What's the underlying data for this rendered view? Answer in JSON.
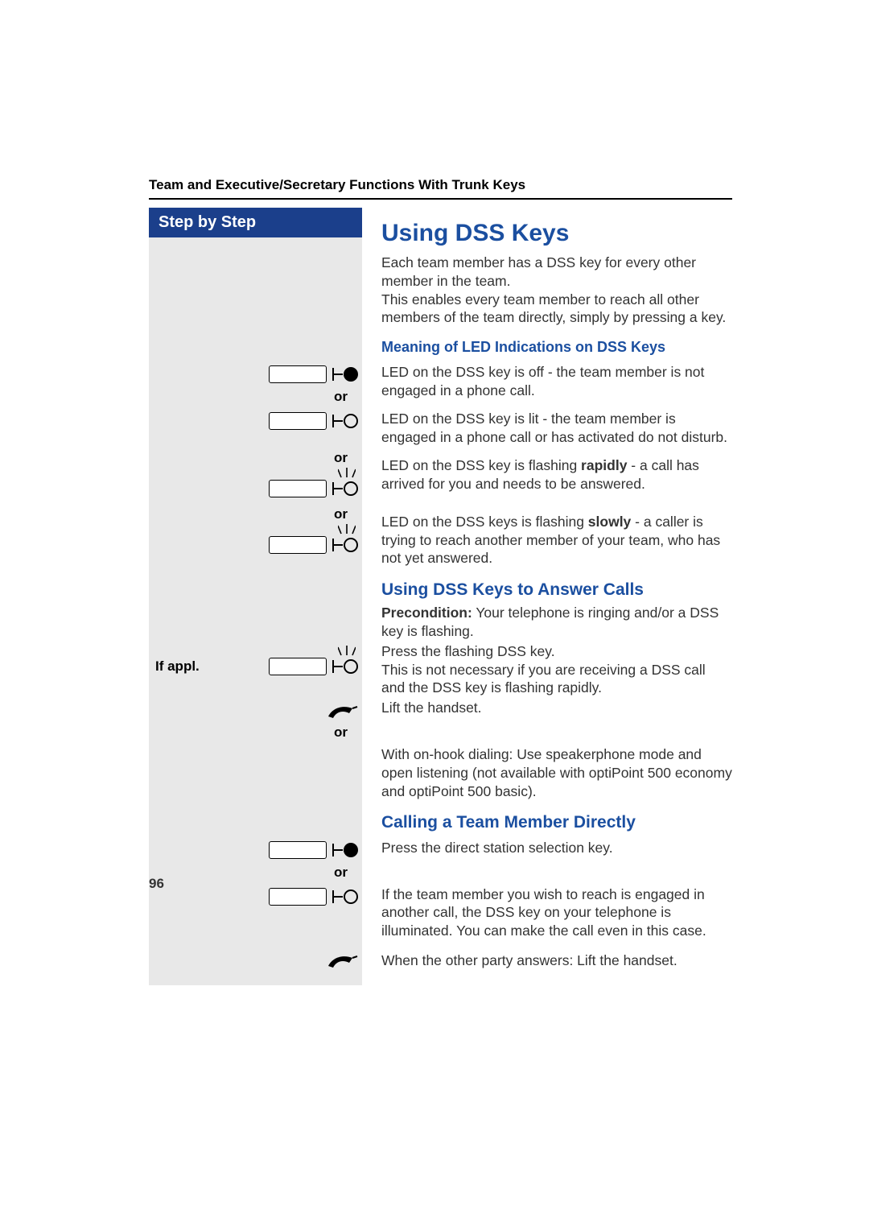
{
  "header": {
    "running": "Team and Executive/Secretary Functions With Trunk Keys",
    "sidebar_title": "Step by Step"
  },
  "section": {
    "title": "Using DSS Keys",
    "intro1": "Each team member has a DSS key for every other member in the team.",
    "intro2": "This enables every team member to reach all other members of the team directly, simply by pressing a key.",
    "led_heading": "Meaning of LED Indications on DSS Keys",
    "led_off": "LED on the DSS key is off - the team member is not engaged in a phone call.",
    "led_lit": "LED on the DSS key is lit - the team member is engaged in a phone call or has activated do not disturb.",
    "led_rapid_pre": "LED on the DSS key is flashing ",
    "led_rapid_bold": "rapidly",
    "led_rapid_post": " - a call has arrived for you and needs to be answered.",
    "led_slow_pre": "LED on the DSS keys is flashing ",
    "led_slow_bold": "slowly",
    "led_slow_post": " - a caller is trying to reach another member of your team, who has not yet answered.",
    "answer_title": "Using DSS Keys to Answer Calls",
    "precond_label": "Precondition:",
    "precond_text": " Your telephone is ringing and/or a DSS key is flashing.",
    "if_appl": "If appl.",
    "press_flash": "Press the flashing DSS key.\nThis is not necessary if you are receiving a DSS call and the DSS key is flashing rapidly.",
    "lift_handset": "Lift the handset.",
    "onhook": "With on-hook dialing: Use speakerphone mode and open listening (not available with optiPoint 500 economy and optiPoint 500 basic).",
    "direct_title": "Calling a Team Member Directly",
    "press_dss": "Press the direct station selection key.",
    "engaged": "If the team member you wish to reach is engaged in another call, the DSS key on your telephone is illuminated. You can make the call even in this case.",
    "answer_lift": "When the other party answers: Lift the handset."
  },
  "labels": {
    "or": "or"
  },
  "page_number": "96"
}
